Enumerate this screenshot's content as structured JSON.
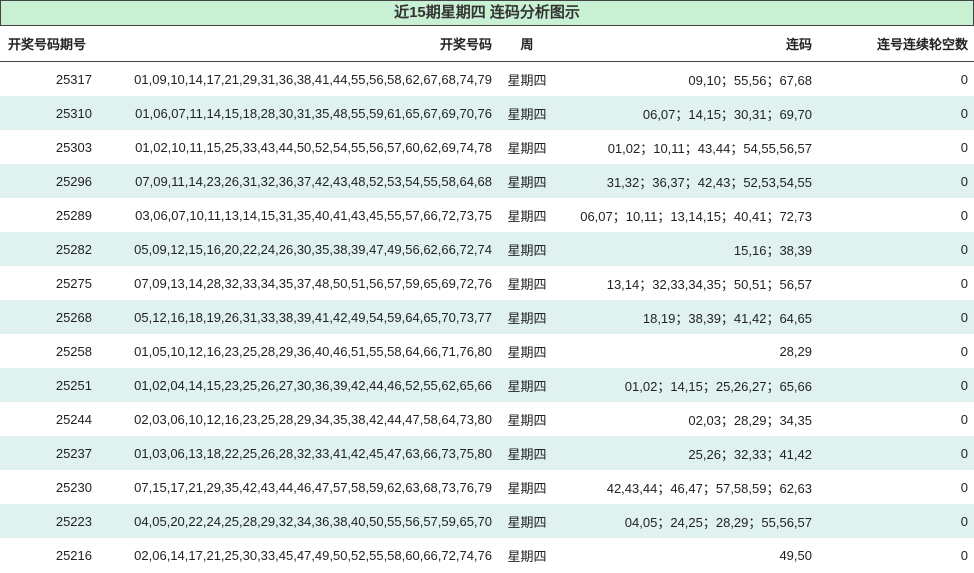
{
  "title": "近15期星期四 连码分析图示",
  "headers": [
    "开奖号码期号",
    "开奖号码",
    "周",
    "连码",
    "连号连续轮空数"
  ],
  "rows": [
    {
      "period": "25317",
      "numbers": "01,09,10,14,17,21,29,31,36,38,41,44,55,56,58,62,67,68,74,79",
      "weekday": "星期四",
      "consecutive": "09,10；55,56；67,68",
      "skip": "0"
    },
    {
      "period": "25310",
      "numbers": "01,06,07,11,14,15,18,28,30,31,35,48,55,59,61,65,67,69,70,76",
      "weekday": "星期四",
      "consecutive": "06,07；14,15；30,31；69,70",
      "skip": "0"
    },
    {
      "period": "25303",
      "numbers": "01,02,10,11,15,25,33,43,44,50,52,54,55,56,57,60,62,69,74,78",
      "weekday": "星期四",
      "consecutive": "01,02；10,11；43,44；54,55,56,57",
      "skip": "0"
    },
    {
      "period": "25296",
      "numbers": "07,09,11,14,23,26,31,32,36,37,42,43,48,52,53,54,55,58,64,68",
      "weekday": "星期四",
      "consecutive": "31,32；36,37；42,43；52,53,54,55",
      "skip": "0"
    },
    {
      "period": "25289",
      "numbers": "03,06,07,10,11,13,14,15,31,35,40,41,43,45,55,57,66,72,73,75",
      "weekday": "星期四",
      "consecutive": "06,07；10,11；13,14,15；40,41；72,73",
      "skip": "0"
    },
    {
      "period": "25282",
      "numbers": "05,09,12,15,16,20,22,24,26,30,35,38,39,47,49,56,62,66,72,74",
      "weekday": "星期四",
      "consecutive": "15,16；38,39",
      "skip": "0"
    },
    {
      "period": "25275",
      "numbers": "07,09,13,14,28,32,33,34,35,37,48,50,51,56,57,59,65,69,72,76",
      "weekday": "星期四",
      "consecutive": "13,14；32,33,34,35；50,51；56,57",
      "skip": "0"
    },
    {
      "period": "25268",
      "numbers": "05,12,16,18,19,26,31,33,38,39,41,42,49,54,59,64,65,70,73,77",
      "weekday": "星期四",
      "consecutive": "18,19；38,39；41,42；64,65",
      "skip": "0"
    },
    {
      "period": "25258",
      "numbers": "01,05,10,12,16,23,25,28,29,36,40,46,51,55,58,64,66,71,76,80",
      "weekday": "星期四",
      "consecutive": "28,29",
      "skip": "0"
    },
    {
      "period": "25251",
      "numbers": "01,02,04,14,15,23,25,26,27,30,36,39,42,44,46,52,55,62,65,66",
      "weekday": "星期四",
      "consecutive": "01,02；14,15；25,26,27；65,66",
      "skip": "0"
    },
    {
      "period": "25244",
      "numbers": "02,03,06,10,12,16,23,25,28,29,34,35,38,42,44,47,58,64,73,80",
      "weekday": "星期四",
      "consecutive": "02,03；28,29；34,35",
      "skip": "0"
    },
    {
      "period": "25237",
      "numbers": "01,03,06,13,18,22,25,26,28,32,33,41,42,45,47,63,66,73,75,80",
      "weekday": "星期四",
      "consecutive": "25,26；32,33；41,42",
      "skip": "0"
    },
    {
      "period": "25230",
      "numbers": "07,15,17,21,29,35,42,43,44,46,47,57,58,59,62,63,68,73,76,79",
      "weekday": "星期四",
      "consecutive": "42,43,44；46,47；57,58,59；62,63",
      "skip": "0"
    },
    {
      "period": "25223",
      "numbers": "04,05,20,22,24,25,28,29,32,34,36,38,40,50,55,56,57,59,65,70",
      "weekday": "星期四",
      "consecutive": "04,05；24,25；28,29；55,56,57",
      "skip": "0"
    },
    {
      "period": "25216",
      "numbers": "02,06,14,17,21,25,30,33,45,47,49,50,52,55,58,60,66,72,74,76",
      "weekday": "星期四",
      "consecutive": "49,50",
      "skip": "0"
    }
  ]
}
